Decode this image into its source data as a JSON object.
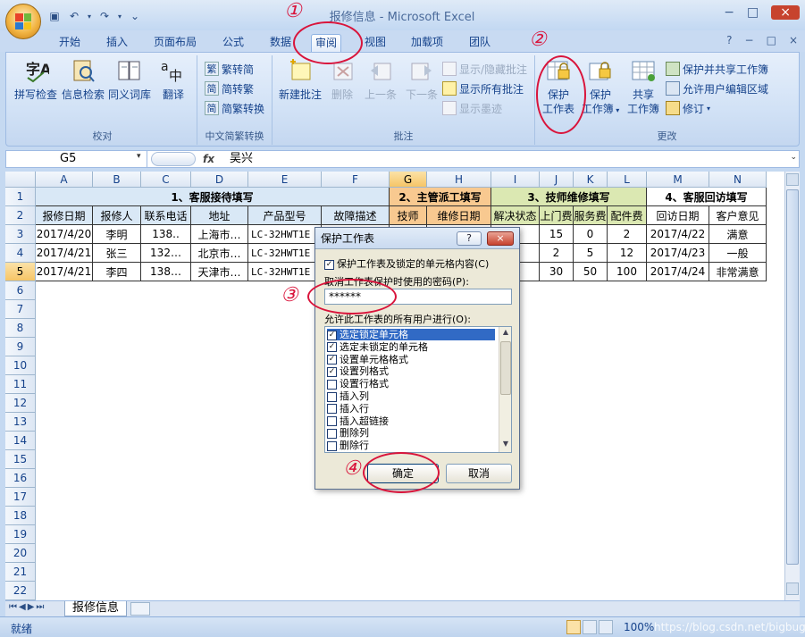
{
  "app": {
    "title": "报修信息 - Microsoft Excel",
    "window_controls": [
      "−",
      "□",
      "×"
    ]
  },
  "ribbon": {
    "tabs": [
      "开始",
      "插入",
      "页面布局",
      "公式",
      "数据",
      "审阅",
      "视图",
      "加载项",
      "团队"
    ],
    "active_tab": "审阅",
    "right_controls": [
      "?",
      "−",
      "□",
      "×"
    ],
    "groups": {
      "proofing": {
        "label": "校对",
        "buttons": [
          "拼写检查",
          "信息检索",
          "同义词库",
          "翻译"
        ]
      },
      "chinese_conversion": {
        "label": "中文简繁转换",
        "buttons": [
          "繁转简",
          "简转繁",
          "简繁转换"
        ]
      },
      "comments": {
        "label": "批注",
        "buttons": [
          "新建批注",
          "删除",
          "上一条",
          "下一条"
        ],
        "small_buttons": [
          "显示/隐藏批注",
          "显示所有批注",
          "显示墨迹"
        ]
      },
      "changes": {
        "label": "更改",
        "protect_sheet": [
          "保护",
          "工作表"
        ],
        "protect_book": [
          "保护",
          "工作簿"
        ],
        "share_book": [
          "共享",
          "工作簿"
        ],
        "small_buttons": [
          "保护并共享工作簿",
          "允许用户编辑区域",
          "修订"
        ]
      }
    }
  },
  "formula_bar": {
    "name_box": "G5",
    "fx": "fx",
    "value": "吴兴"
  },
  "sheet": {
    "columns": [
      "A",
      "B",
      "C",
      "D",
      "E",
      "F",
      "G",
      "H",
      "I",
      "J",
      "K",
      "L",
      "M",
      "N"
    ],
    "active_column": "G",
    "active_row": "5",
    "row_numbers": [
      "1",
      "2",
      "3",
      "4",
      "5",
      "6",
      "7",
      "8",
      "9",
      "10",
      "11",
      "12",
      "13",
      "14",
      "15",
      "16",
      "17",
      "18",
      "19",
      "20",
      "21",
      "22"
    ],
    "section_headers": [
      "1、客服接待填写",
      "2、主管派工填写",
      "3、技师维修填写",
      "4、客服回访填写"
    ],
    "field_headers": [
      "报修日期",
      "报修人",
      "联系电话",
      "地址",
      "产品型号",
      "故障描述",
      "技师",
      "维修日期",
      "解决状态",
      "上门费",
      "服务费",
      "配件费",
      "回访日期",
      "客户意见"
    ],
    "rows": [
      [
        "2017/4/20",
        "李明",
        "138..",
        "上海市…",
        "LC-32HWT1E",
        "",
        "",
        "",
        "决",
        "15",
        "0",
        "2",
        "2017/4/22",
        "满意"
      ],
      [
        "2017/4/21",
        "张三",
        "132…",
        "北京市…",
        "LC-32HWT1E",
        "",
        "",
        "",
        "决",
        "2",
        "5",
        "12",
        "2017/4/23",
        "一般"
      ],
      [
        "2017/4/21",
        "李四",
        "138…",
        "天津市…",
        "LC-32HWT1E",
        "",
        "",
        "",
        "决",
        "30",
        "50",
        "100",
        "2017/4/24",
        "非常满意"
      ]
    ],
    "sheet_tab": "报修信息"
  },
  "status_bar": {
    "ready": "就绪",
    "zoom": "100%",
    "watermark": "https://blog.csdn.net/bigbug"
  },
  "dialog": {
    "title": "保护工作表",
    "help": "?",
    "close": "×",
    "protect_option": "保护工作表及锁定的单元格内容(C)",
    "password_label": "取消工作表保护时使用的密码(P):",
    "password_value": "******",
    "allow_label": "允许此工作表的所有用户进行(O):",
    "permissions": [
      {
        "label": "选定锁定单元格",
        "checked": true
      },
      {
        "label": "选定未锁定的单元格",
        "checked": true
      },
      {
        "label": "设置单元格格式",
        "checked": true
      },
      {
        "label": "设置列格式",
        "checked": true
      },
      {
        "label": "设置行格式",
        "checked": false
      },
      {
        "label": "插入列",
        "checked": false
      },
      {
        "label": "插入行",
        "checked": false
      },
      {
        "label": "插入超链接",
        "checked": false
      },
      {
        "label": "删除列",
        "checked": false
      },
      {
        "label": "删除行",
        "checked": false
      }
    ],
    "ok": "确定",
    "cancel": "取消"
  },
  "annotations": [
    "①",
    "②",
    "③",
    "④"
  ],
  "colors": {
    "annotation_red": "#d9143b",
    "section1": "#d9e8f6",
    "section2": "#f8c990",
    "section3": "#dbe8b2",
    "section4": "#ffffff"
  }
}
